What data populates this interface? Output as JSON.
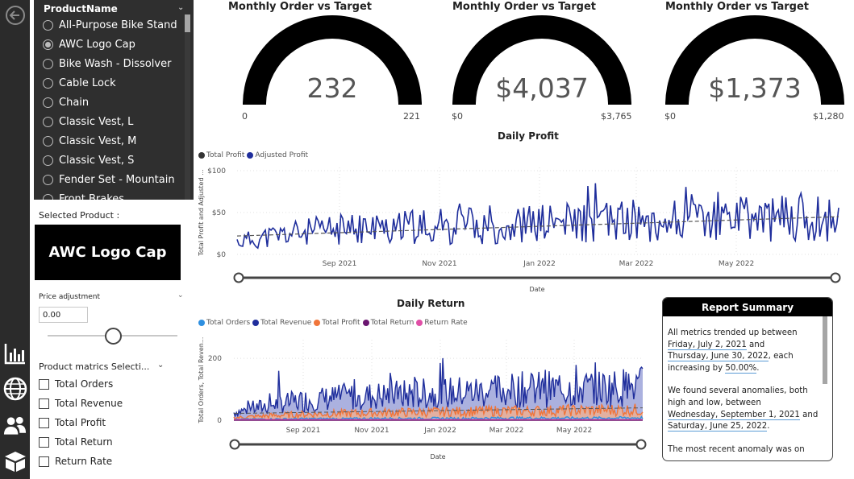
{
  "nav": {
    "icons": [
      "back-arrow-icon",
      "bar-chart-icon",
      "globe-icon",
      "users-icon",
      "box-icon"
    ]
  },
  "slicer": {
    "header": "ProductName",
    "options": [
      "All-Purpose Bike Stand",
      "AWC Logo Cap",
      "Bike Wash - Dissolver",
      "Cable Lock",
      "Chain",
      "Classic Vest, L",
      "Classic Vest, M",
      "Classic Vest, S",
      "Fender Set - Mountain",
      "Front Brakes"
    ],
    "selected_index": 1
  },
  "selected_product": {
    "label": "Selected Product :",
    "value": "AWC Logo Cap"
  },
  "price_adjustment": {
    "label": "Price adjustment",
    "value": "0.00",
    "slider_level": 0.5
  },
  "product_metrics": {
    "label": "Product matrics Selecti...",
    "options": [
      "Total Orders",
      "Total Revenue",
      "Total Profit",
      "Total Return",
      "Return Rate"
    ]
  },
  "gauges": [
    {
      "title": "Monthly Order vs Target",
      "value": "232",
      "min": "0",
      "max": "221",
      "fill_fraction": 1.0
    },
    {
      "title": "Monthly Order vs Target",
      "value": "$4,037",
      "min": "$0",
      "max": "$3,765",
      "fill_fraction": 1.0
    },
    {
      "title": "Monthly Order vs Target",
      "value": "$1,373",
      "min": "$0",
      "max": "$1,280",
      "fill_fraction": 1.0
    }
  ],
  "daily_profit": {
    "title": "Daily Profit",
    "legend": [
      {
        "name": "Total Profit",
        "color": "#333333"
      },
      {
        "name": "Adjusted Profit",
        "color": "#1f2e9c"
      }
    ],
    "ylabel": "Total Profit and Adjusted ...",
    "xlabel": "Date",
    "yticks": [
      "$100",
      "$50",
      "$0"
    ],
    "xticks": [
      "Sep 2021",
      "Nov 2021",
      "Jan 2022",
      "Mar 2022",
      "May 2022"
    ]
  },
  "daily_return": {
    "title": "Daily Return",
    "legend": [
      {
        "name": "Total Orders",
        "color": "#2e8fe0"
      },
      {
        "name": "Total Revenue",
        "color": "#1f2e9c"
      },
      {
        "name": "Total Profit",
        "color": "#f0753a"
      },
      {
        "name": "Total Return",
        "color": "#6b1670"
      },
      {
        "name": "Return Rate",
        "color": "#e04fa6"
      }
    ],
    "ylabel": "Total Orders, Total Reven...",
    "xlabel": "Date",
    "yticks": [
      "200",
      "0"
    ],
    "xticks": [
      "Sep 2021",
      "Nov 2021",
      "Jan 2022",
      "Mar 2022",
      "May 2022"
    ]
  },
  "chart_data": [
    {
      "type": "line",
      "title": "Daily Profit",
      "xlabel": "Date",
      "ylabel": "Total Profit and Adjusted ...",
      "ylim": [
        0,
        100
      ],
      "x_range": [
        "2021-07-02",
        "2022-06-30"
      ],
      "series": [
        {
          "name": "Adjusted Profit",
          "approx_monthly_mean": [
            15,
            25,
            30,
            32,
            34,
            35,
            38,
            40,
            41,
            42,
            43,
            44
          ],
          "approx_peak": 85
        },
        {
          "name": "Total Profit",
          "trend_start": 22,
          "trend_end": 45
        }
      ]
    },
    {
      "type": "area",
      "title": "Daily Return",
      "xlabel": "Date",
      "ylabel": "Total Orders, Total Reven...",
      "ylim": [
        0,
        260
      ],
      "x_range": [
        "2021-07-02",
        "2022-06-30"
      ],
      "series": [
        {
          "name": "Total Revenue",
          "approx_monthly_mean": [
            25,
            50,
            65,
            75,
            80,
            85,
            90,
            95,
            100,
            100,
            105,
            110
          ],
          "approx_peak": 250
        },
        {
          "name": "Total Profit",
          "approx_monthly_mean": [
            8,
            15,
            20,
            22,
            25,
            26,
            28,
            30,
            30,
            32,
            33,
            34
          ]
        },
        {
          "name": "Total Orders",
          "approx_monthly_mean": [
            3,
            4,
            5,
            5,
            6,
            6,
            6,
            7,
            7,
            7,
            7,
            8
          ]
        },
        {
          "name": "Total Return",
          "approx_monthly_mean": [
            0,
            0,
            0,
            0,
            0,
            0,
            0,
            0,
            0,
            0,
            0,
            0
          ]
        },
        {
          "name": "Return Rate",
          "approx_monthly_mean": [
            0,
            0,
            0,
            0,
            0,
            0,
            0,
            0,
            0,
            0,
            0,
            0
          ]
        }
      ]
    }
  ],
  "report_summary": {
    "title": "Report Summary",
    "p1_a": "All metrics trended up between",
    "p1_d1": "Friday, July 2, 2021",
    "p1_b": " and",
    "p1_d2": "Thursday, June 30, 2022",
    "p1_c": ", each increasing by ",
    "p1_pct": "50.00%",
    "p1_d": ".",
    "p2_a": "We found several anomalies, both high and low, between",
    "p2_d1": "Wednesday, September 1, 2021",
    "p2_b": " and",
    "p2_d2": "Saturday, June 25, 2022",
    "p2_c": ".",
    "p3": "The most recent anomaly was on"
  }
}
